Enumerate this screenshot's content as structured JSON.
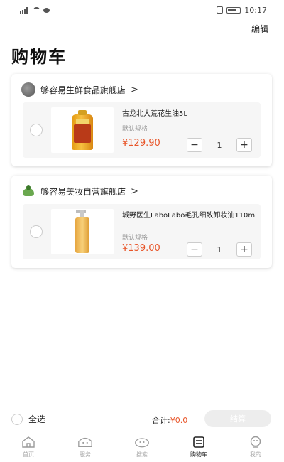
{
  "status_bar": {
    "time": "10:17"
  },
  "header": {
    "title": "购物车",
    "edit_label": "编辑"
  },
  "stores": [
    {
      "name": "够容易生鲜食品旗舰店",
      "logo_icon": "store-logo-gray",
      "item": {
        "name": "古龙北大荒花生油5L",
        "spec": "默认规格",
        "price": "¥129.90",
        "quantity": "1",
        "checked": false
      }
    },
    {
      "name": "够容易美妆自营旗舰店",
      "logo_icon": "store-logo-green",
      "item": {
        "name": "城野医生LaboLabo毛孔细致卸妆油110ml",
        "spec": "默认规格",
        "price": "¥139.00",
        "quantity": "1",
        "checked": false
      }
    }
  ],
  "bottom_bar": {
    "select_all_label": "全选",
    "total_label": "合计:",
    "total_amount": "¥0.0",
    "checkout_label": "结算"
  },
  "tabs": [
    {
      "label": "首页",
      "icon": "home-icon",
      "active": false
    },
    {
      "label": "服务",
      "icon": "service-icon",
      "active": false
    },
    {
      "label": "搜索",
      "icon": "search-icon",
      "active": false
    },
    {
      "label": "购物车",
      "icon": "cart-icon",
      "active": true
    },
    {
      "label": "我的",
      "icon": "profile-icon",
      "active": false
    }
  ],
  "colors": {
    "price": "#e8562a",
    "checkout_disabled": "#ededed"
  }
}
